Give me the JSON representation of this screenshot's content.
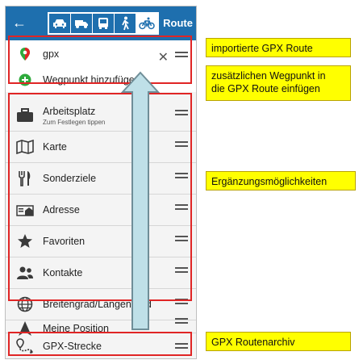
{
  "topbar": {
    "back_icon": "arrow-left-icon",
    "modes": [
      {
        "name": "car",
        "icon": "car-icon"
      },
      {
        "name": "truck",
        "icon": "truck-icon"
      },
      {
        "name": "bus",
        "icon": "bus-icon"
      },
      {
        "name": "walk",
        "icon": "pedestrian-icon"
      },
      {
        "name": "bike",
        "icon": "bicycle-icon"
      }
    ],
    "title": "Route"
  },
  "route_input": {
    "value": "gpx",
    "add_waypoint": "Wegpunkt hinzufügen"
  },
  "list": {
    "items": [
      {
        "label": "Arbeitsplatz",
        "sub": "Zum Festlegen tippen",
        "icon": "briefcase-icon"
      },
      {
        "label": "Karte",
        "icon": "map-icon"
      },
      {
        "label": "Sonderziele",
        "icon": "cutlery-icon"
      },
      {
        "label": "Adresse",
        "icon": "address-icon"
      },
      {
        "label": "Favoriten",
        "icon": "star-icon"
      },
      {
        "label": "Kontakte",
        "icon": "contacts-icon"
      },
      {
        "label": "Breitengrad/Längengrad",
        "icon": "globe-icon"
      },
      {
        "label": "Meine Position",
        "icon": "navigation-arrow-icon"
      },
      {
        "label": "GPX-Strecke",
        "icon": "gpx-route-icon"
      }
    ]
  },
  "annotations": {
    "callout_1": "importierte GPX Route",
    "callout_2_line1": "zusätzlichen Wegpunkt in",
    "callout_2_line2": "die GPX Route einfügen",
    "callout_3": "Ergänzungsmöglichkeiten",
    "callout_4": "GPX Routenarchiv"
  },
  "colors": {
    "topbar": "#1e6fae",
    "annotation_box": "#e02525",
    "callout_fill": "#ffff00",
    "arrow_fill": "#bfe0e8",
    "add_icon": "#2eaa3c"
  }
}
